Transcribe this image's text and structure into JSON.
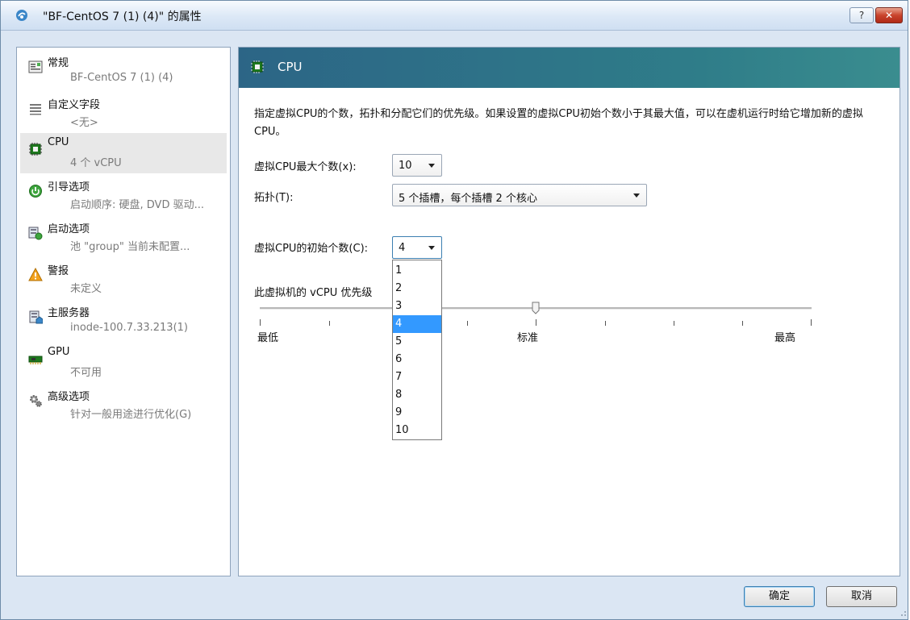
{
  "window": {
    "title": "\"BF-CentOS 7 (1) (4)\" 的属性",
    "help_label": "?",
    "close_label": "✕"
  },
  "nav": {
    "items": [
      {
        "title": "常规",
        "sub": "BF-CentOS 7 (1) (4)",
        "icon": "general-icon"
      },
      {
        "title": "自定义字段",
        "sub": "<无>",
        "icon": "custom-fields-icon"
      },
      {
        "title": "CPU",
        "sub": "4 个 vCPU",
        "icon": "cpu-icon"
      },
      {
        "title": "引导选项",
        "sub": "启动顺序: 硬盘, DVD 驱动...",
        "icon": "boot-options-icon"
      },
      {
        "title": "启动选项",
        "sub": "池 \"group\" 当前未配置...",
        "icon": "start-options-icon"
      },
      {
        "title": "警报",
        "sub": "未定义",
        "icon": "alert-icon"
      },
      {
        "title": "主服务器",
        "sub": "inode-100.7.33.213(1)",
        "icon": "home-server-icon"
      },
      {
        "title": "GPU",
        "sub": "不可用",
        "icon": "gpu-icon"
      },
      {
        "title": "高级选项",
        "sub": "针对一般用途进行优化(G)",
        "icon": "advanced-options-icon"
      }
    ],
    "selected": "CPU"
  },
  "panel": {
    "title": "CPU",
    "description": "指定虚拟CPU的个数，拓扑和分配它们的优先级。如果设置的虚拟CPU初始个数小于其最大值，可以在虚机运行时给它增加新的虚拟CPU。",
    "max_vcpu_label": "虚拟CPU最大个数(x):",
    "max_vcpu_value": "10",
    "topology_label": "拓扑(T):",
    "topology_value": "5 个插槽，每个插槽 2 个核心",
    "initial_vcpu_label": "虚拟CPU的初始个数(C):",
    "initial_vcpu_value": "4",
    "initial_vcpu_options": [
      "1",
      "2",
      "3",
      "4",
      "5",
      "6",
      "7",
      "8",
      "9",
      "10"
    ],
    "priority_label": "此虚拟机的 vCPU 优先级",
    "priority_min": "最低",
    "priority_mid": "标准",
    "priority_max": "最高",
    "priority_level": 0.5
  },
  "buttons": {
    "ok": "确定",
    "cancel": "取消"
  },
  "colors": {
    "header_bg": "#2c6586",
    "highlight": "#3399ff"
  }
}
